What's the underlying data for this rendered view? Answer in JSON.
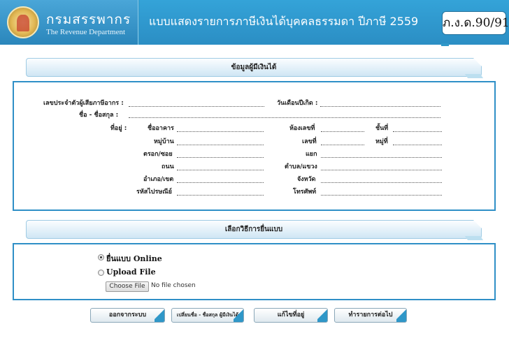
{
  "header": {
    "agency_th": "กรมสรรพากร",
    "agency_en": "The Revenue Department",
    "title": "แบบแสดงรายการภาษีเงินได้บุคคลธรรมดา ปีภาษี 2559",
    "form_code": "ภ.ง.ด.90/91",
    "logo_icon": "revenue-department-seal"
  },
  "taxpayer_section": {
    "heading": "ข้อมูลผู้มีเงินได้",
    "tax_id_label": "เลขประจำตัวผู้เสียภาษีอากร :",
    "birthdate_label": "วันเดือนปีเกิด :",
    "name_label": "ชื่อ - ชื่อสกุล :",
    "address_label": "ที่อยู่ :",
    "building_label": "ชื่ออาคาร",
    "room_label": "ห้องเลขที่",
    "floor_label": "ชั้นที่",
    "village_label": "หมู่บ้าน",
    "house_no_label": "เลขที่",
    "moo_label": "หมู่ที่",
    "soi_label": "ตรอก/ซอย",
    "junction_label": "แยก",
    "road_label": "ถนน",
    "subdistrict_label": "ตำบล/แขวง",
    "district_label": "อำเภอ/เขต",
    "province_label": "จังหวัด",
    "postcode_label": "รหัสไปรษณีย์",
    "phone_label": "โทรศัพท์"
  },
  "filing_section": {
    "heading": "เลือกวิธีการยื่นแบบ",
    "option_online": "ยื่นแบบ Online",
    "option_upload": "Upload File",
    "selected": "online",
    "choose_file_label": "Choose File",
    "file_status": "No file chosen"
  },
  "actions": {
    "logout": "ออกจากระบบ",
    "change_name": "เปลี่ยนชื่อ - ชื่อสกุล ผู้มีเงินได้",
    "edit_address": "แก้ไขที่อยู่",
    "next": "ทำรายการต่อไป"
  },
  "colors": {
    "accent": "#2f97c8",
    "panel_border": "#2f8fc7"
  }
}
